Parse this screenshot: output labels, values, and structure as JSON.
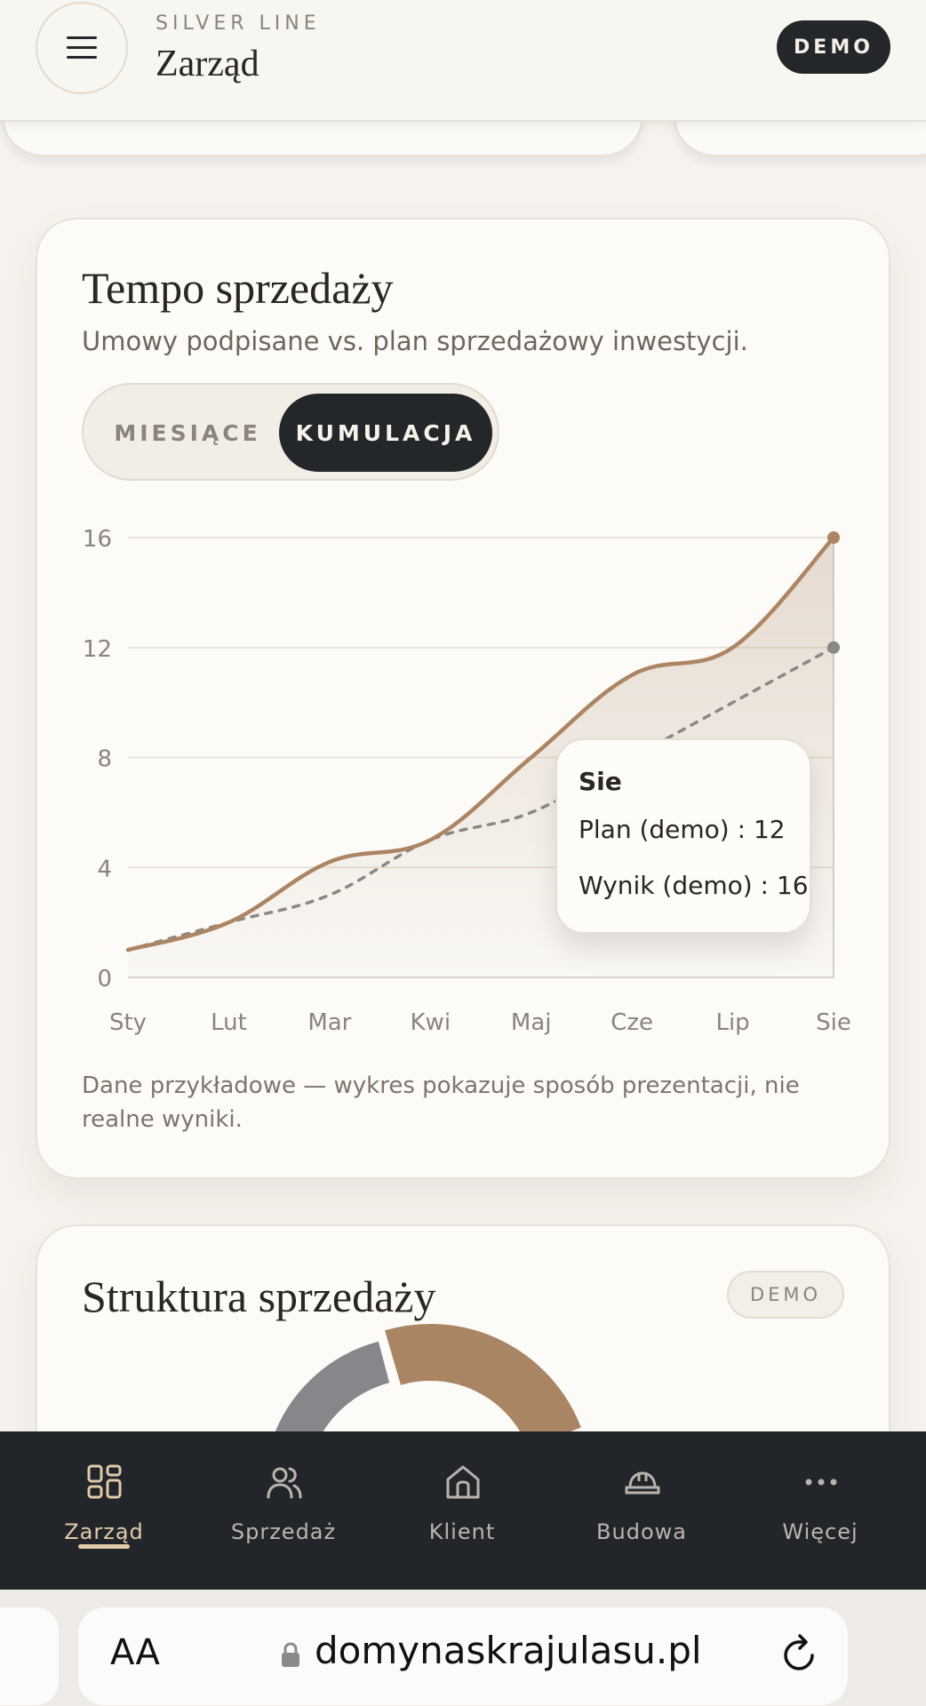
{
  "header": {
    "kicker": "SILVER LINE",
    "title": "Zarząd",
    "demo_label": "DEMO"
  },
  "sales_pace_card": {
    "title": "Tempo sprzedaży",
    "subtitle": "Umowy podpisane vs. plan sprzedażowy inwestycji.",
    "toggle": {
      "options": [
        "MIESIĄCE",
        "KUMULACJA"
      ],
      "selected": "KUMULACJA"
    },
    "tooltip": {
      "month": "Sie",
      "plan_text": "Plan (demo) : 12",
      "result_text": "Wynik (demo) : 16"
    },
    "note": "Dane przykładowe — wykres pokazuje sposób prezentacji, nie realne wyniki."
  },
  "structure_card": {
    "title": "Struktura sprzedaży",
    "badge": "DEMO"
  },
  "chart_data": {
    "type": "area",
    "categories": [
      "Sty",
      "Lut",
      "Mar",
      "Kwi",
      "Maj",
      "Cze",
      "Lip",
      "Sie"
    ],
    "yticks": [
      0,
      4,
      8,
      12,
      16
    ],
    "ylim": [
      0,
      16
    ],
    "grid": true,
    "series": [
      {
        "name": "Wynik (demo)",
        "values": [
          1,
          2,
          4.2,
          5,
          8,
          11,
          12,
          16
        ],
        "color": "#ab8564",
        "style": "solid-area"
      },
      {
        "name": "Plan (demo)",
        "values": [
          1,
          2,
          3,
          5,
          6,
          8,
          10,
          12
        ],
        "color": "#8a8784",
        "style": "dashed"
      }
    ]
  },
  "bottom_nav": {
    "items": [
      {
        "label": "Zarząd",
        "icon": "dashboard-grid-icon",
        "active": true
      },
      {
        "label": "Sprzedaż",
        "icon": "users-icon",
        "active": false
      },
      {
        "label": "Klient",
        "icon": "home-icon",
        "active": false
      },
      {
        "label": "Budowa",
        "icon": "hard-hat-icon",
        "active": false
      },
      {
        "label": "Więcej",
        "icon": "more-dots-icon",
        "active": false
      }
    ]
  },
  "browser": {
    "text_size_label": "AA",
    "url": "domynaskrajulasu.pl"
  }
}
